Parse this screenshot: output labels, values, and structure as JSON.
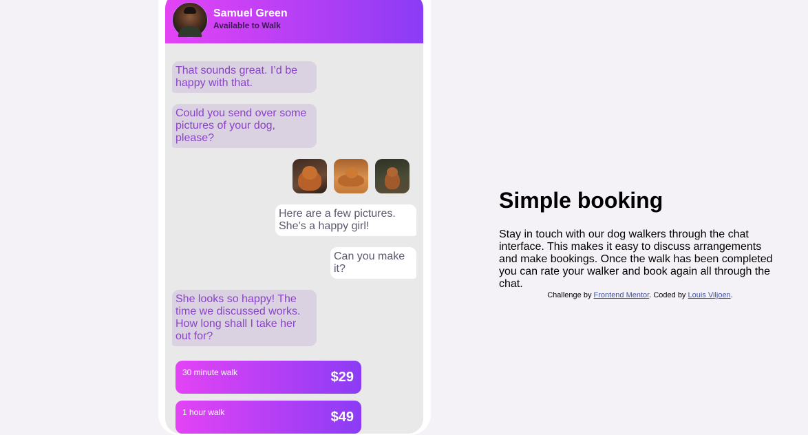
{
  "chat": {
    "walker_name": "Samuel Green",
    "walker_status": "Available to Walk",
    "messages": [
      {
        "from": "them",
        "text": "That sounds great. I’d be happy with that."
      },
      {
        "from": "them",
        "text": "Could you send over some pictures of your dog, please?"
      },
      {
        "from": "me",
        "text": "Here are a few pictures. She’s a happy girl!"
      },
      {
        "from": "me",
        "text": "Can you make it?"
      },
      {
        "from": "them",
        "text": "She looks so happy! The time we discussed works. How long shall I take her out for?"
      }
    ],
    "offers": [
      {
        "label": "30 minute walk",
        "price": "$29"
      },
      {
        "label": "1 hour walk",
        "price": "$49"
      }
    ]
  },
  "info": {
    "title": "Simple booking",
    "description": "Stay in touch with our dog walkers through the chat interface. This makes it easy to discuss arrangements and make bookings. Once the walk has been completed you can rate your walker and book again all through the chat.",
    "attribution": {
      "prefix": "Challenge by ",
      "link1": "Frontend Mentor",
      "middle": ". Coded by ",
      "link2": "Louis Viljoen",
      "suffix": "."
    }
  },
  "colors": {
    "gradient_start": "#e443f5",
    "gradient_end": "#8b3cf5",
    "them_bubble": "#dad2e1",
    "them_text": "#8a42c8",
    "me_text": "#5a586b",
    "page_bg": "#f4f2f6"
  }
}
